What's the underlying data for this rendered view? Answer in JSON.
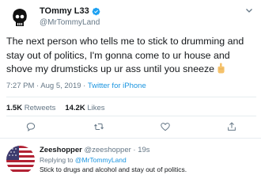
{
  "tweet": {
    "display_name": "TOmmy L33",
    "handle": "@MrTommyLand",
    "text": "The next person who tells me to stick to drumming and stay out of politics, I'm gonna come to ur house and shove my drumsticks up ur ass until you sneeze",
    "emoji": "🖕",
    "time": "7:27 PM · Aug 5, 2019 · ",
    "source": "Twitter for iPhone"
  },
  "stats": {
    "retweets_count": "1.5K",
    "retweets_label": "Retweets",
    "likes_count": "14.2K",
    "likes_label": "Likes"
  },
  "icons": {
    "verified": "verified-badge-icon",
    "more": "chevron-down-icon",
    "reply": "reply-icon",
    "retweet": "retweet-icon",
    "like": "heart-icon",
    "share": "share-icon"
  },
  "reply": {
    "name": "Zeeshopper",
    "handle_time": "@zeeshopper · 19s",
    "replying_prefix": "Replying to ",
    "replying_handle": "@MrTommyLand",
    "text": "Stick to drugs and alcohol and stay out of politics."
  },
  "colors": {
    "brand_blue": "#1da1f2",
    "link_blue": "#1b95e0",
    "muted_text": "#657786",
    "divider": "#e6ecf0"
  }
}
